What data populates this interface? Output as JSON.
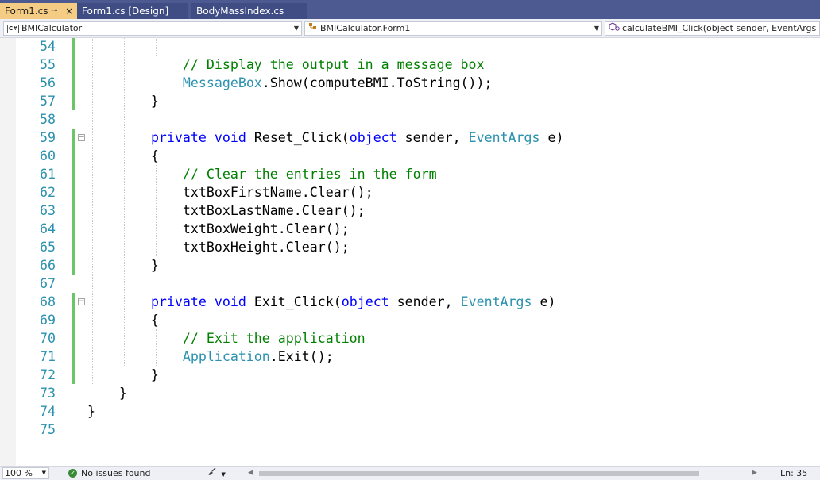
{
  "tabs": [
    {
      "label": "Form1.cs",
      "active": true,
      "pin": "⊸",
      "close": "×"
    },
    {
      "label": "Form1.cs [Design]",
      "active": false
    },
    {
      "label": "BodyMassIndex.cs",
      "active": false
    }
  ],
  "navbar": {
    "project": {
      "icon_text": "C#",
      "label": "BMICalculator"
    },
    "type": {
      "label": "BMICalculator.Form1"
    },
    "member": {
      "label": "calculateBMI_Click(object sender, EventArgs e)"
    }
  },
  "colors": {
    "keyword": "#0000ff",
    "type": "#2b91af",
    "comment": "#008000",
    "line_number": "#2b91af",
    "change_bar": "#6cc668",
    "tab_strip": "#4d5a92",
    "active_tab": "#f5cc84"
  },
  "code": {
    "lines": [
      {
        "num": "54",
        "tokens": []
      },
      {
        "num": "55",
        "tokens": [
          {
            "t": "            "
          },
          {
            "t": "// Display the output in a message box",
            "c": "cm"
          }
        ]
      },
      {
        "num": "56",
        "tokens": [
          {
            "t": "            "
          },
          {
            "t": "MessageBox",
            "c": "ty"
          },
          {
            "t": ".Show(computeBMI.ToString());"
          }
        ]
      },
      {
        "num": "57",
        "tokens": [
          {
            "t": "        }"
          }
        ]
      },
      {
        "num": "58",
        "tokens": []
      },
      {
        "num": "59",
        "tokens": [
          {
            "t": "        "
          },
          {
            "t": "private",
            "c": "kw"
          },
          {
            "t": " "
          },
          {
            "t": "void",
            "c": "kw"
          },
          {
            "t": " Reset_Click("
          },
          {
            "t": "object",
            "c": "kw"
          },
          {
            "t": " sender, "
          },
          {
            "t": "EventArgs",
            "c": "ty"
          },
          {
            "t": " e)"
          }
        ]
      },
      {
        "num": "60",
        "tokens": [
          {
            "t": "        {"
          }
        ]
      },
      {
        "num": "61",
        "tokens": [
          {
            "t": "            "
          },
          {
            "t": "// Clear the entries in the form",
            "c": "cm"
          }
        ]
      },
      {
        "num": "62",
        "tokens": [
          {
            "t": "            txtBoxFirstName.Clear();"
          }
        ]
      },
      {
        "num": "63",
        "tokens": [
          {
            "t": "            txtBoxLastName.Clear();"
          }
        ]
      },
      {
        "num": "64",
        "tokens": [
          {
            "t": "            txtBoxWeight.Clear();"
          }
        ]
      },
      {
        "num": "65",
        "tokens": [
          {
            "t": "            txtBoxHeight.Clear();"
          }
        ]
      },
      {
        "num": "66",
        "tokens": [
          {
            "t": "        }"
          }
        ]
      },
      {
        "num": "67",
        "tokens": []
      },
      {
        "num": "68",
        "tokens": [
          {
            "t": "        "
          },
          {
            "t": "private",
            "c": "kw"
          },
          {
            "t": " "
          },
          {
            "t": "void",
            "c": "kw"
          },
          {
            "t": " Exit_Click("
          },
          {
            "t": "object",
            "c": "kw"
          },
          {
            "t": " sender, "
          },
          {
            "t": "EventArgs",
            "c": "ty"
          },
          {
            "t": " e)"
          }
        ]
      },
      {
        "num": "69",
        "tokens": [
          {
            "t": "        {"
          }
        ]
      },
      {
        "num": "70",
        "tokens": [
          {
            "t": "            "
          },
          {
            "t": "// Exit the application",
            "c": "cm"
          }
        ]
      },
      {
        "num": "71",
        "tokens": [
          {
            "t": "            "
          },
          {
            "t": "Application",
            "c": "ty"
          },
          {
            "t": ".Exit();"
          }
        ]
      },
      {
        "num": "72",
        "tokens": [
          {
            "t": "        }"
          }
        ]
      },
      {
        "num": "73",
        "tokens": [
          {
            "t": "    }"
          }
        ]
      },
      {
        "num": "74",
        "tokens": [
          {
            "t": "}"
          }
        ]
      },
      {
        "num": "75",
        "tokens": []
      }
    ],
    "fold_marker": "−"
  },
  "statusbar": {
    "zoom": "100 %",
    "issues_icon": "✓",
    "issues": "No issues found",
    "brush_icon": "brush-icon",
    "position": "Ln: 35"
  }
}
